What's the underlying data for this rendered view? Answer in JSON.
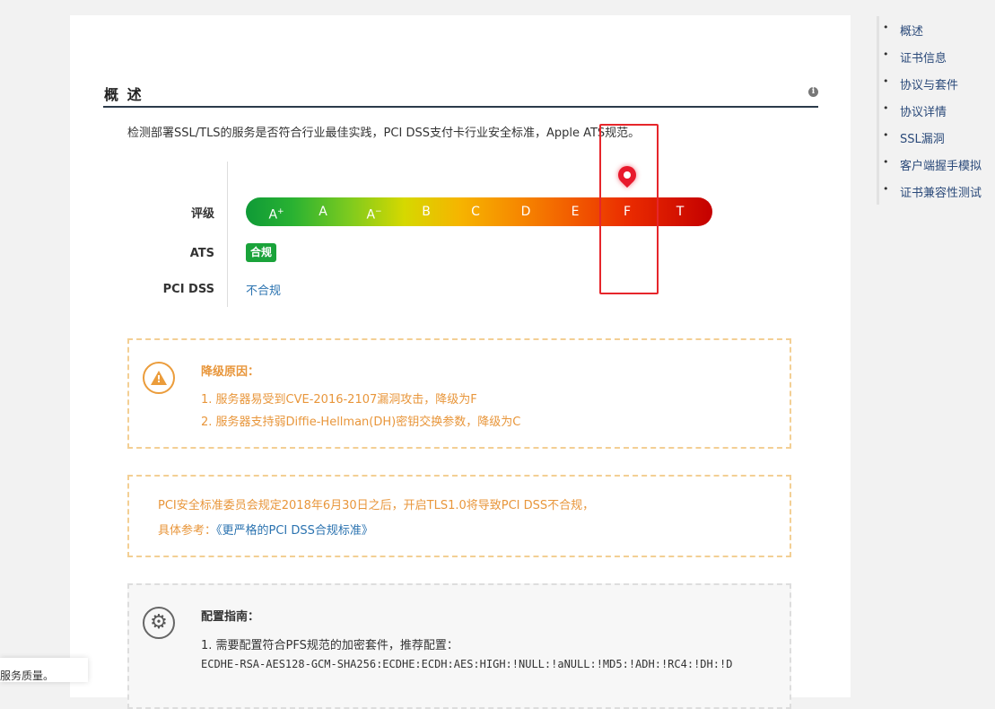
{
  "section": {
    "title": "概 述",
    "info_icon": "info-icon"
  },
  "description": "检测部署SSL/TLS的服务是否符合行业最佳实践，PCI DSS支付卡行业安全标准，Apple ATS规范。",
  "grade": {
    "label": "评级",
    "letters": [
      "A+",
      "A",
      "A−",
      "B",
      "C",
      "D",
      "E",
      "F",
      "T"
    ],
    "current": "F",
    "marker_icon": "map-pin-icon"
  },
  "ats": {
    "label": "ATS",
    "badge": "合规",
    "badge_color": "#1aa33a"
  },
  "pci": {
    "label": "PCI DSS",
    "status": "不合规",
    "status_color": "#2b73b0"
  },
  "downgrade": {
    "icon": "warning-icon",
    "title": "降级原因：",
    "reasons": [
      "1. 服务器易受到CVE-2016-2107漏洞攻击，降级为F",
      "2. 服务器支持弱Diffie-Hellman(DH)密钥交换参数，降级为C"
    ],
    "color": "#e8963b"
  },
  "pci_notice": {
    "line1": "PCI安全标准委员会规定2018年6月30日之后，开启TLS1.0将导致PCI DSS不合规，",
    "line2_prefix": "具体参考：",
    "line2_link": "《更严格的PCI DSS合规标准》"
  },
  "guide": {
    "icon": "gear-icon",
    "title": "配置指南：",
    "line1": "1. 需要配置符合PFS规范的加密套件，推荐配置：",
    "code": "ECDHE-RSA-AES128-GCM-SHA256:ECDHE:ECDH:AES:HIGH:!NULL:!aNULL:!MD5:!ADH:!RC4:!DH:!D"
  },
  "toc": [
    "概述",
    "证书信息",
    "协议与套件",
    "协议详情",
    "SSL漏洞",
    "客户端握手模拟",
    "证书兼容性测试"
  ],
  "toast": {
    "text": "服务质量。"
  }
}
